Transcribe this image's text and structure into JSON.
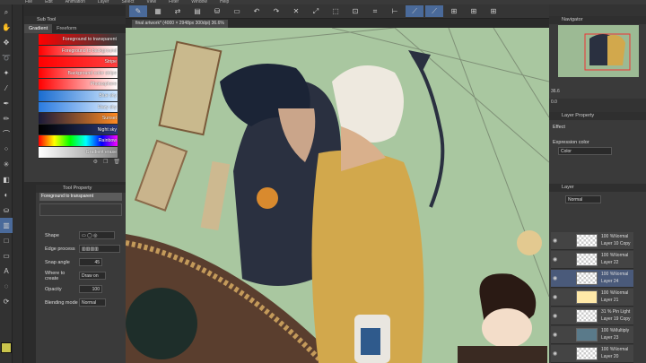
{
  "menu": {
    "items": [
      "File",
      "Edit",
      "Animation",
      "Layer",
      "Select",
      "View",
      "Filter",
      "Window",
      "Help"
    ]
  },
  "subtool": {
    "title": "Sub Tool",
    "tabs": [
      "Gradient",
      "Freeform"
    ],
    "gradients": [
      {
        "label": "Foreground to transparent",
        "colors": [
          "#ff0000",
          "#ff000000"
        ]
      },
      {
        "label": "Foreground to background",
        "colors": [
          "#ff0000",
          "#ffffff"
        ]
      },
      {
        "label": "Stripe",
        "colors": [
          "#ff0000",
          "#ff4040"
        ]
      },
      {
        "label": "Background color stripe",
        "colors": [
          "#ff0000",
          "#ffffff"
        ]
      },
      {
        "label": "Photosphere",
        "colors": [
          "#ff0000",
          "#ffffff"
        ]
      },
      {
        "label": "Blue sky",
        "colors": [
          "#1a6cd0",
          "#cfe7ff"
        ]
      },
      {
        "label": "Hazy sky",
        "colors": [
          "#2a7be0",
          "#e0eeff"
        ]
      },
      {
        "label": "Sunset",
        "colors": [
          "#1a1a3a",
          "#ff8a20"
        ]
      },
      {
        "label": "Night sky",
        "colors": [
          "#000000",
          "#2a3a7a"
        ]
      },
      {
        "label": "Rainbow",
        "colors": [
          "#ff0000",
          "#ffff00",
          "#00ff00",
          "#00ffff",
          "#0000ff",
          "#ff00ff"
        ]
      },
      {
        "label": "Gradient erase",
        "colors": [
          "#ffffff",
          "#888888"
        ]
      }
    ]
  },
  "toolprop": {
    "title": "Tool Property",
    "gradient_name": "Foreground to transparent",
    "shape_label": "Shape",
    "edge_label": "Edge process",
    "snap_label": "Snap angle",
    "snap_value": "45",
    "where_label": "Where to create",
    "where_value": "Draw on",
    "opacity_label": "Opacity",
    "opacity_value": "100",
    "blend_label": "Blending mode",
    "blend_value": "Normal"
  },
  "document": {
    "tab": "final artwork* (4000 × 2948px 300dpi) 36.6%"
  },
  "navigator": {
    "title": "Navigator",
    "zoom": "36.6",
    "rotate": "0.0"
  },
  "layer_property": {
    "title": "Layer Property",
    "effect_label": "Effect",
    "expression_label": "Expression color",
    "expression_value": "Color"
  },
  "layer_panel": {
    "title": "Layer",
    "blend": "Normal",
    "layers": [
      {
        "mode": "100 %Normal",
        "name": "Layer 10 Copy",
        "selected": false
      },
      {
        "mode": "100 %Normal",
        "name": "Layer 22",
        "selected": false
      },
      {
        "mode": "100 %Normal",
        "name": "Layer 24",
        "selected": true
      },
      {
        "mode": "100 %Normal",
        "name": "Layer 21",
        "selected": false
      },
      {
        "mode": "31 % Pin Light",
        "name": "Layer 19 Copy",
        "selected": false
      },
      {
        "mode": "100 %Multiply",
        "name": "Layer 23",
        "selected": false
      },
      {
        "mode": "100 %Normal",
        "name": "Layer 20",
        "selected": false
      }
    ]
  }
}
